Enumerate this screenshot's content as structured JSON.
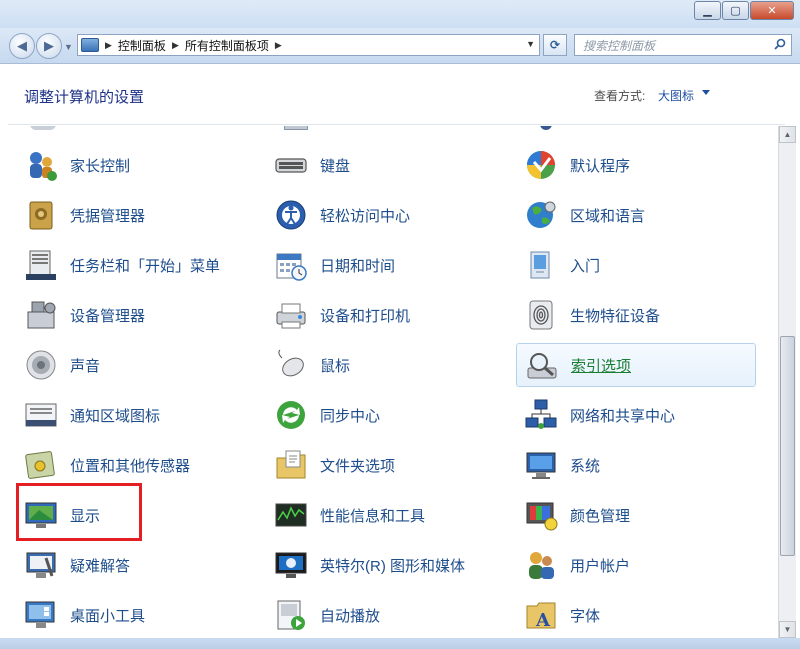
{
  "window": {
    "minimize_icon": "minimize-icon",
    "maximize_icon": "maximize-icon",
    "close_icon": "close-icon"
  },
  "nav": {
    "breadcrumb": [
      "控制面板",
      "所有控制面板项"
    ],
    "search_placeholder": "搜索控制面板"
  },
  "header": {
    "title": "调整计算机的设置",
    "view_by_label": "查看方式:",
    "view_by_value": "大图标"
  },
  "items": [
    {
      "label": "家长控制",
      "icon": "parental-controls-icon"
    },
    {
      "label": "键盘",
      "icon": "keyboard-icon"
    },
    {
      "label": "默认程序",
      "icon": "default-programs-icon"
    },
    {
      "label": "凭据管理器",
      "icon": "credential-manager-icon"
    },
    {
      "label": "轻松访问中心",
      "icon": "ease-of-access-icon"
    },
    {
      "label": "区域和语言",
      "icon": "region-language-icon"
    },
    {
      "label": "任务栏和「开始」菜单",
      "icon": "taskbar-icon"
    },
    {
      "label": "日期和时间",
      "icon": "date-time-icon"
    },
    {
      "label": "入门",
      "icon": "getting-started-icon"
    },
    {
      "label": "设备管理器",
      "icon": "device-manager-icon"
    },
    {
      "label": "设备和打印机",
      "icon": "devices-printers-icon"
    },
    {
      "label": "生物特征设备",
      "icon": "biometric-icon"
    },
    {
      "label": "声音",
      "icon": "sound-icon"
    },
    {
      "label": "鼠标",
      "icon": "mouse-icon"
    },
    {
      "label": "索引选项",
      "icon": "indexing-options-icon"
    },
    {
      "label": "通知区域图标",
      "icon": "notification-area-icon"
    },
    {
      "label": "同步中心",
      "icon": "sync-center-icon"
    },
    {
      "label": "网络和共享中心",
      "icon": "network-sharing-icon"
    },
    {
      "label": "位置和其他传感器",
      "icon": "location-sensors-icon"
    },
    {
      "label": "文件夹选项",
      "icon": "folder-options-icon"
    },
    {
      "label": "系统",
      "icon": "system-icon"
    },
    {
      "label": "显示",
      "icon": "display-icon"
    },
    {
      "label": "性能信息和工具",
      "icon": "performance-icon"
    },
    {
      "label": "颜色管理",
      "icon": "color-management-icon"
    },
    {
      "label": "疑难解答",
      "icon": "troubleshooting-icon"
    },
    {
      "label": "英特尔(R) 图形和媒体",
      "icon": "intel-graphics-icon"
    },
    {
      "label": "用户帐户",
      "icon": "user-accounts-icon"
    },
    {
      "label": "桌面小工具",
      "icon": "desktop-gadgets-icon"
    },
    {
      "label": "自动播放",
      "icon": "autoplay-icon"
    },
    {
      "label": "字体",
      "icon": "fonts-icon"
    }
  ],
  "highlighted_item": "显示",
  "hovered_item": "索引选项"
}
